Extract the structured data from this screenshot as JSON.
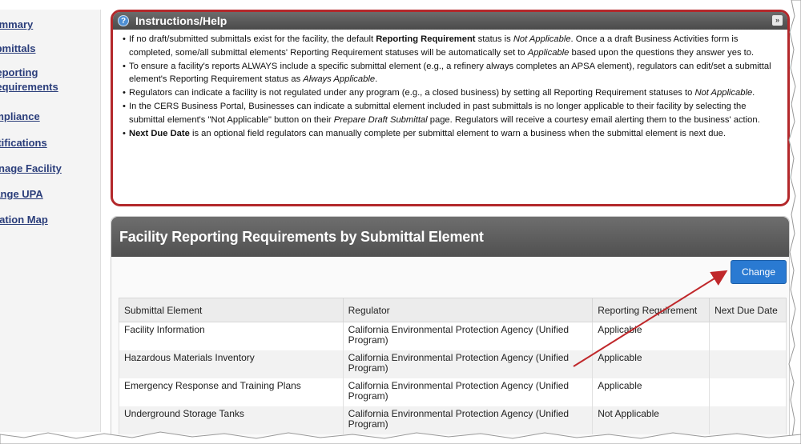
{
  "sidebar": {
    "items": [
      {
        "label": "Summary"
      },
      {
        "label": "Submittals"
      },
      {
        "label": "Reporting Requirements"
      },
      {
        "label": "Compliance"
      },
      {
        "label": "Notifications"
      },
      {
        "label": "Manage Facility"
      },
      {
        "label": "Change UPA"
      },
      {
        "label": "Location Map"
      }
    ]
  },
  "help": {
    "title": "Instructions/Help",
    "items": [
      {
        "parts": [
          "If no draft/submitted submittals exist for the facility, the default ",
          "Reporting Requirement",
          " status is ",
          "Not Applicable",
          ". Once a a draft Business Activities form is completed, some/all submittal elements' Reporting Requirement statuses will be automatically set to ",
          "Applicable",
          " based upon the questions they answer yes to."
        ]
      },
      {
        "parts": [
          "To ensure a facility's reports ALWAYS include a specific submittal element (e.g., a refinery always completes an APSA element), regulators can edit/set a submittal element's Reporting Requirement status as ",
          "Always Applicable",
          "."
        ]
      },
      {
        "parts": [
          "Regulators can indicate a facility is not regulated under any program (e.g., a closed business) by setting all Reporting Requirement statuses to ",
          "Not Applicable",
          "."
        ]
      },
      {
        "parts": [
          "In the CERS Business Portal, Businesses can indicate a submittal element included in past submittals is no longer applicable to their facility by selecting the submittal element's \"Not Applicable\" button on their ",
          "Prepare Draft Submittal",
          " page. Regulators will receive a courtesy email alerting them to the business' action."
        ]
      },
      {
        "parts": [
          "Next Due Date",
          " is an optional field regulators can manually complete per submittal element to warn a business when the submittal element is next due."
        ]
      }
    ]
  },
  "requirements": {
    "title": "Facility Reporting Requirements by Submittal Element",
    "change_label": "Change",
    "columns": [
      "Submittal Element",
      "Regulator",
      "Reporting Requirement",
      "Next Due Date"
    ],
    "rows": [
      {
        "element": "Facility Information",
        "regulator": "California Environmental Protection Agency (Unified Program)",
        "requirement": "Applicable",
        "due": ""
      },
      {
        "element": "Hazardous Materials Inventory",
        "regulator": "California Environmental Protection Agency (Unified Program)",
        "requirement": "Applicable",
        "due": ""
      },
      {
        "element": "Emergency Response and Training Plans",
        "regulator": "California Environmental Protection Agency (Unified Program)",
        "requirement": "Applicable",
        "due": ""
      },
      {
        "element": "Underground Storage Tanks",
        "regulator": "California Environmental Protection Agency (Unified Program)",
        "requirement": "Not Applicable",
        "due": ""
      }
    ]
  },
  "colors": {
    "highlight_border": "#b3282b",
    "button_blue": "#2a7ad2",
    "header_gray": "#5a5a5a",
    "link_blue": "#2a3d7a"
  }
}
